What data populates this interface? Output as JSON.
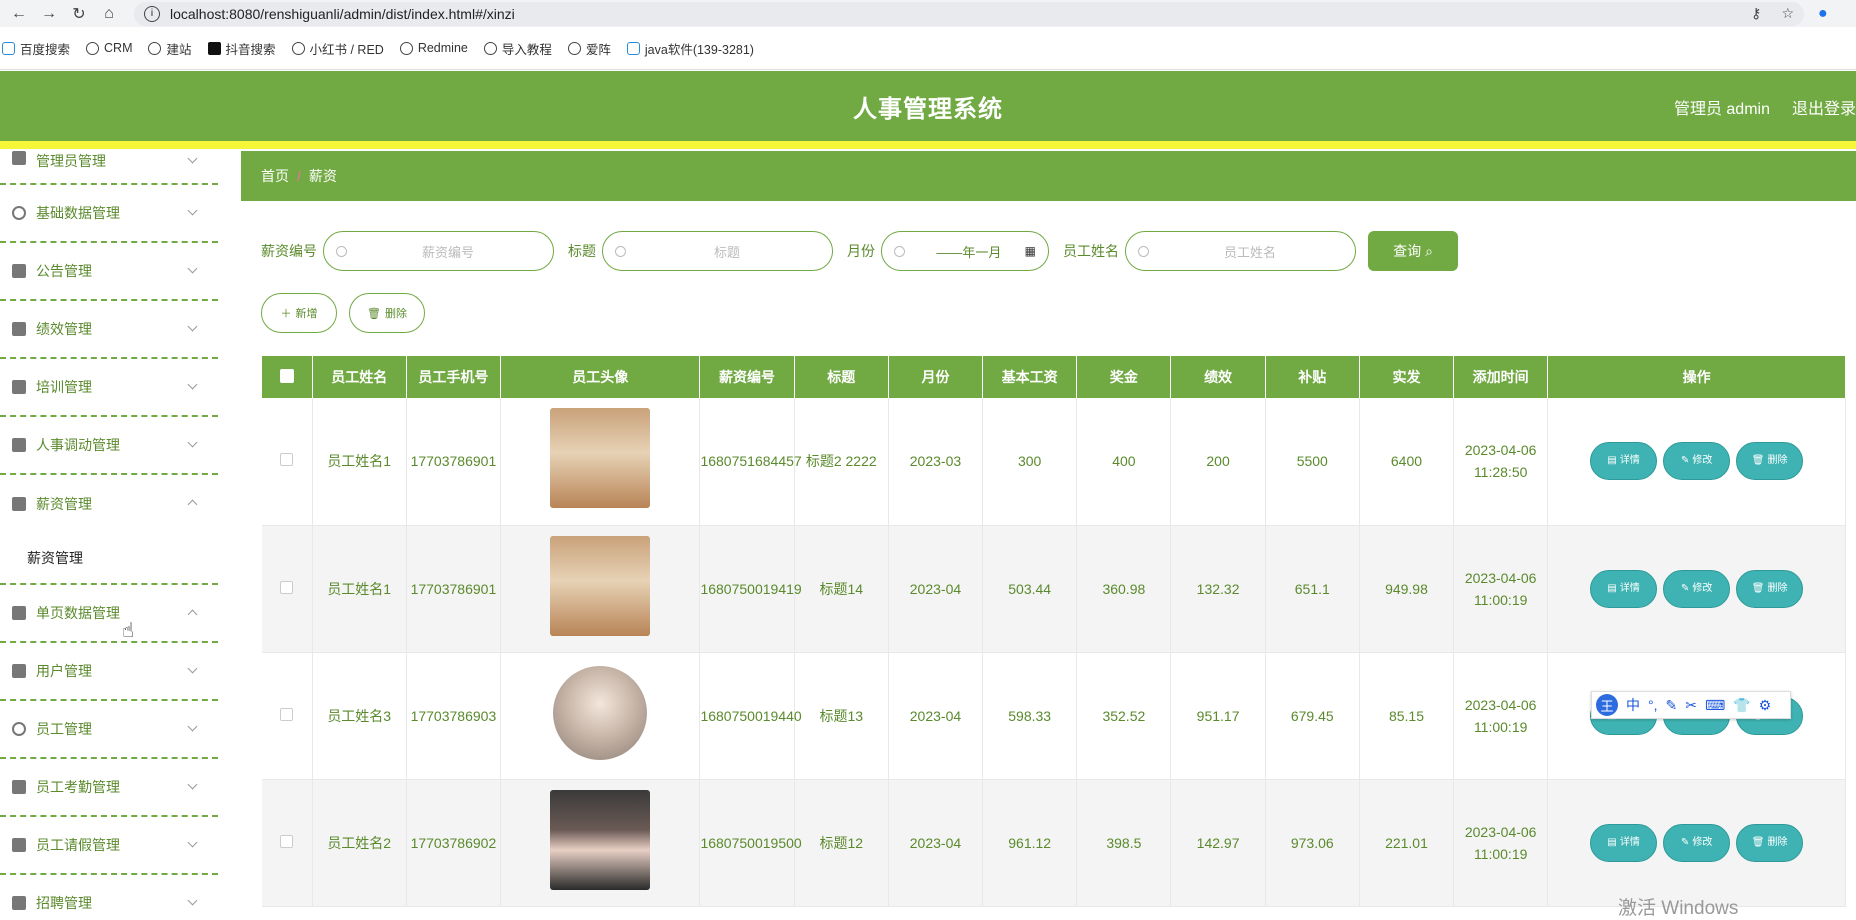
{
  "browser": {
    "url": "localhost:8080/renshiguanli/admin/dist/index.html#/xinzi",
    "bookmarks": [
      "百度搜索",
      "CRM",
      "建站",
      "抖音搜索",
      "小红书 / RED",
      "Redmine",
      "导入教程",
      "爱阵",
      "java软件(139-3281)"
    ]
  },
  "header": {
    "title": "人事管理系统",
    "user": "管理员 admin",
    "logout": "退出登录"
  },
  "sidebar": {
    "items": [
      {
        "label": "管理员管理"
      },
      {
        "label": "基础数据管理"
      },
      {
        "label": "公告管理"
      },
      {
        "label": "绩效管理"
      },
      {
        "label": "培训管理"
      },
      {
        "label": "人事调动管理"
      },
      {
        "label": "薪资管理"
      },
      {
        "label": "单页数据管理"
      },
      {
        "label": "用户管理"
      },
      {
        "label": "员工管理"
      },
      {
        "label": "员工考勤管理"
      },
      {
        "label": "员工请假管理"
      },
      {
        "label": "招聘管理"
      }
    ],
    "submenu": "薪资管理"
  },
  "breadcrumb": {
    "home": "首页",
    "sep": "/",
    "current": "薪资"
  },
  "search": {
    "salary_no_label": "薪资编号",
    "salary_no_ph": "薪资编号",
    "title_label": "标题",
    "title_ph": "标题",
    "month_label": "月份",
    "month_ph": "——年一月",
    "name_label": "员工姓名",
    "name_ph": "员工姓名",
    "query_btn": "查询"
  },
  "actions": {
    "add": "新增",
    "delete": "删除"
  },
  "table": {
    "headers": [
      "员工姓名",
      "员工手机号",
      "员工头像",
      "薪资编号",
      "标题",
      "月份",
      "基本工资",
      "奖金",
      "绩效",
      "补贴",
      "实发",
      "添加时间",
      "操作"
    ],
    "rows": [
      {
        "name": "员工姓名1",
        "phone": "17703786901",
        "salary_no": "1680751684457",
        "title": "标题2 2222",
        "month": "2023-03",
        "base": "300",
        "bonus": "400",
        "perf": "200",
        "subsidy": "5500",
        "net": "6400",
        "added": "2023-04-06 11:28:50"
      },
      {
        "name": "员工姓名1",
        "phone": "17703786901",
        "salary_no": "1680750019419",
        "title": "标题14",
        "month": "2023-04",
        "base": "503.44",
        "bonus": "360.98",
        "perf": "132.32",
        "subsidy": "651.1",
        "net": "949.98",
        "added": "2023-04-06 11:00:19"
      },
      {
        "name": "员工姓名3",
        "phone": "17703786903",
        "salary_no": "1680750019440",
        "title": "标题13",
        "month": "2023-04",
        "base": "598.33",
        "bonus": "352.52",
        "perf": "951.17",
        "subsidy": "679.45",
        "net": "85.15",
        "added": "2023-04-06 11:00:19"
      },
      {
        "name": "员工姓名2",
        "phone": "17703786902",
        "salary_no": "1680750019500",
        "title": "标题12",
        "month": "2023-04",
        "base": "961.12",
        "bonus": "398.5",
        "perf": "142.97",
        "subsidy": "973.06",
        "net": "221.01",
        "added": "2023-04-06 11:00:19"
      }
    ],
    "op_detail": "详情",
    "op_edit": "修改",
    "op_delete": "删除"
  },
  "ime": {
    "logo": "王",
    "mode": "中"
  },
  "watermark": "激活 Windows",
  "colors": {
    "primary": "#71a943",
    "accent_yellow": "#f6f638",
    "teal": "#3fb3b3"
  }
}
